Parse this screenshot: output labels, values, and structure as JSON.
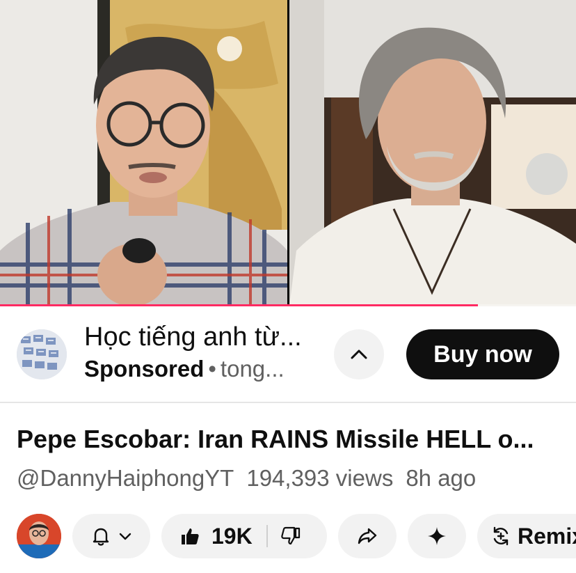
{
  "player": {
    "progress_fraction": 0.83
  },
  "ad": {
    "title": "Học tiếng anh từ...",
    "sponsored_label": "Sponsored",
    "separator": "•",
    "advertiser": "tong...",
    "collapse_icon": "chevron-up-icon",
    "buy_label": "Buy now"
  },
  "video": {
    "title": "Pepe Escobar: Iran RAINS Missile HELL o...",
    "channel": "@DannyHaiphongYT",
    "views": "194,393 views",
    "age": "8h ago"
  },
  "actions": {
    "subscribe_icon": "bell-icon",
    "like_count": "19K",
    "share_icon": "share-icon",
    "ask_icon": "sparkle-icon",
    "remix_label": "Remix"
  },
  "colors": {
    "progress": "#ff2a62",
    "buy_button": "#0f0f0f",
    "pill_bg": "#f2f2f2",
    "secondary_text": "#606060"
  }
}
